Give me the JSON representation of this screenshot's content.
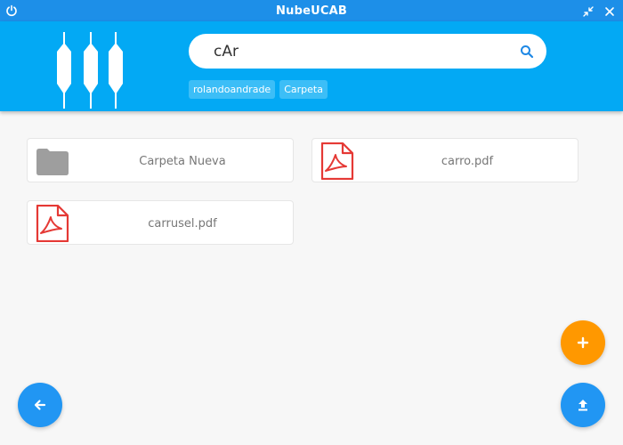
{
  "window": {
    "title": "NubeUCAB"
  },
  "search": {
    "value": "cAr"
  },
  "chips": [
    {
      "label": "rolandoandrade"
    },
    {
      "label": "Carpeta"
    }
  ],
  "items": [
    {
      "name": "Carpeta Nueva",
      "type": "folder",
      "icon": "folder-icon"
    },
    {
      "name": "carro.pdf",
      "type": "pdf",
      "icon": "pdf-icon"
    },
    {
      "name": "carrusel.pdf",
      "type": "pdf",
      "icon": "pdf-icon"
    }
  ],
  "fabs": {
    "add": {
      "icon": "plus-icon",
      "color": "#ff9800"
    },
    "upload": {
      "icon": "upload-icon",
      "color": "#2196f3"
    },
    "back": {
      "icon": "arrow-left-icon",
      "color": "#2196f3"
    }
  },
  "colors": {
    "titlebar": "#1d8fe8",
    "header": "#03a9f4",
    "chip": "#3cbef7",
    "pdf": "#e53935",
    "folder": "#9e9e9e"
  }
}
